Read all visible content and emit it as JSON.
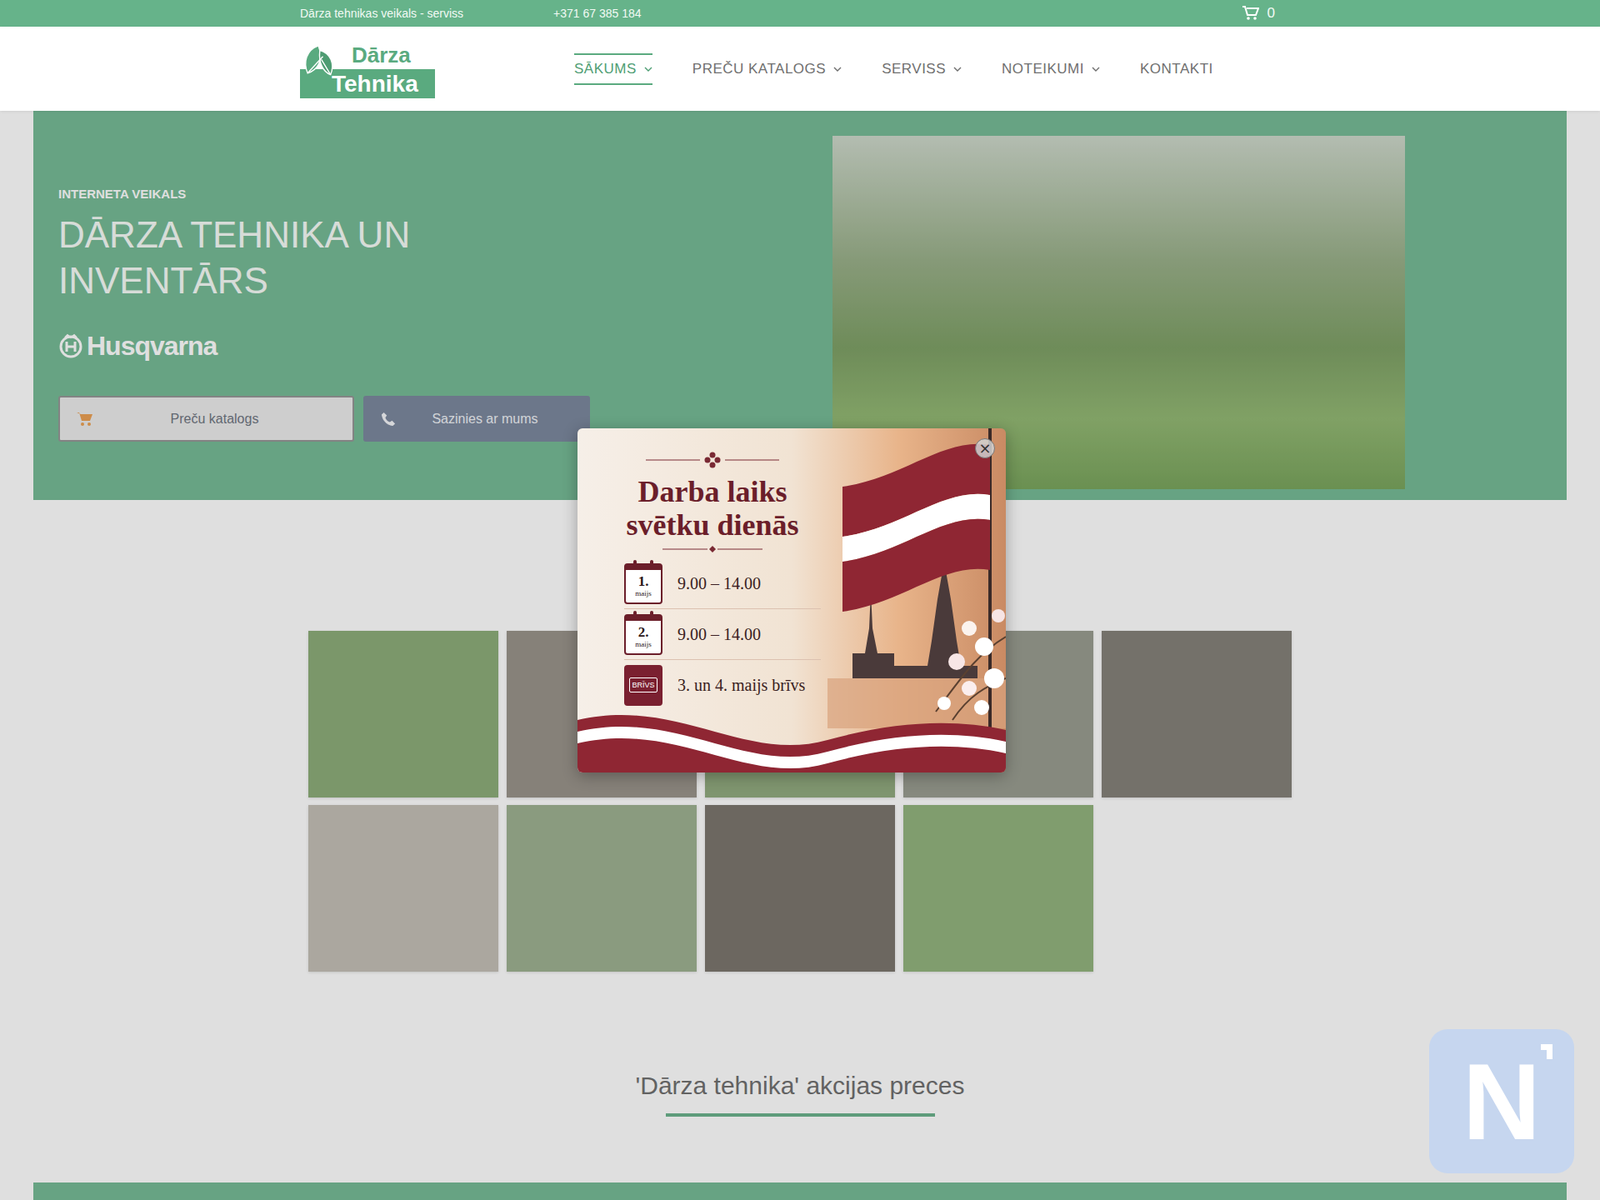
{
  "top_bar": {
    "shop_text": "Dārza tehnikas veikals - serviss",
    "phone": "+371 67 385 184",
    "cart_count": "0"
  },
  "header": {
    "logo": {
      "line1": "Dārza",
      "line2": "Tehnika"
    },
    "nav": [
      {
        "label": "SĀKUMS",
        "selected": true,
        "has_dropdown": true
      },
      {
        "label": "PREČU KATALOGS",
        "selected": false,
        "has_dropdown": true
      },
      {
        "label": "SERVISS",
        "selected": false,
        "has_dropdown": true
      },
      {
        "label": "NOTEIKUMI",
        "selected": false,
        "has_dropdown": true
      },
      {
        "label": "KONTAKTI",
        "selected": false,
        "has_dropdown": false
      }
    ]
  },
  "hero": {
    "eyebrow": "INTERNETA VEIKALS",
    "title_lines": [
      "DĀRZA TEHNIKA UN",
      "INVENTĀRS"
    ],
    "brand": "Husqvarna",
    "buttons": [
      {
        "label": "Preču katalogs",
        "kind": "catalog"
      },
      {
        "label": "Sazinies ar mums",
        "kind": "contact"
      }
    ]
  },
  "gallery": {
    "tiles": [
      {
        "color": "#7fa36a"
      },
      {
        "color": "#8d877d"
      },
      {
        "color": "#84a070"
      },
      {
        "color": "#8e9183"
      },
      {
        "color": "#77736a"
      },
      {
        "color": "#bdb8ae"
      },
      {
        "color": "#93a884"
      },
      {
        "color": "#6c665d"
      },
      {
        "color": "#86ab6f"
      }
    ]
  },
  "section_title": "'Dārza tehnika' akcijas preces",
  "modal": {
    "close": "×",
    "title_lines": [
      "Darba laiks",
      "svētku dienās"
    ],
    "rows": [
      {
        "kind": "date",
        "day": "1.",
        "month": "maijs",
        "text": "9.00 – 14.00"
      },
      {
        "kind": "date",
        "day": "2.",
        "month": "maijs",
        "text": "9.00 – 14.00"
      },
      {
        "kind": "closed",
        "badge": "BRĪVS",
        "text": "3. un 4. maijs brīvs"
      }
    ]
  },
  "chat_badge": {
    "letter": "N"
  }
}
